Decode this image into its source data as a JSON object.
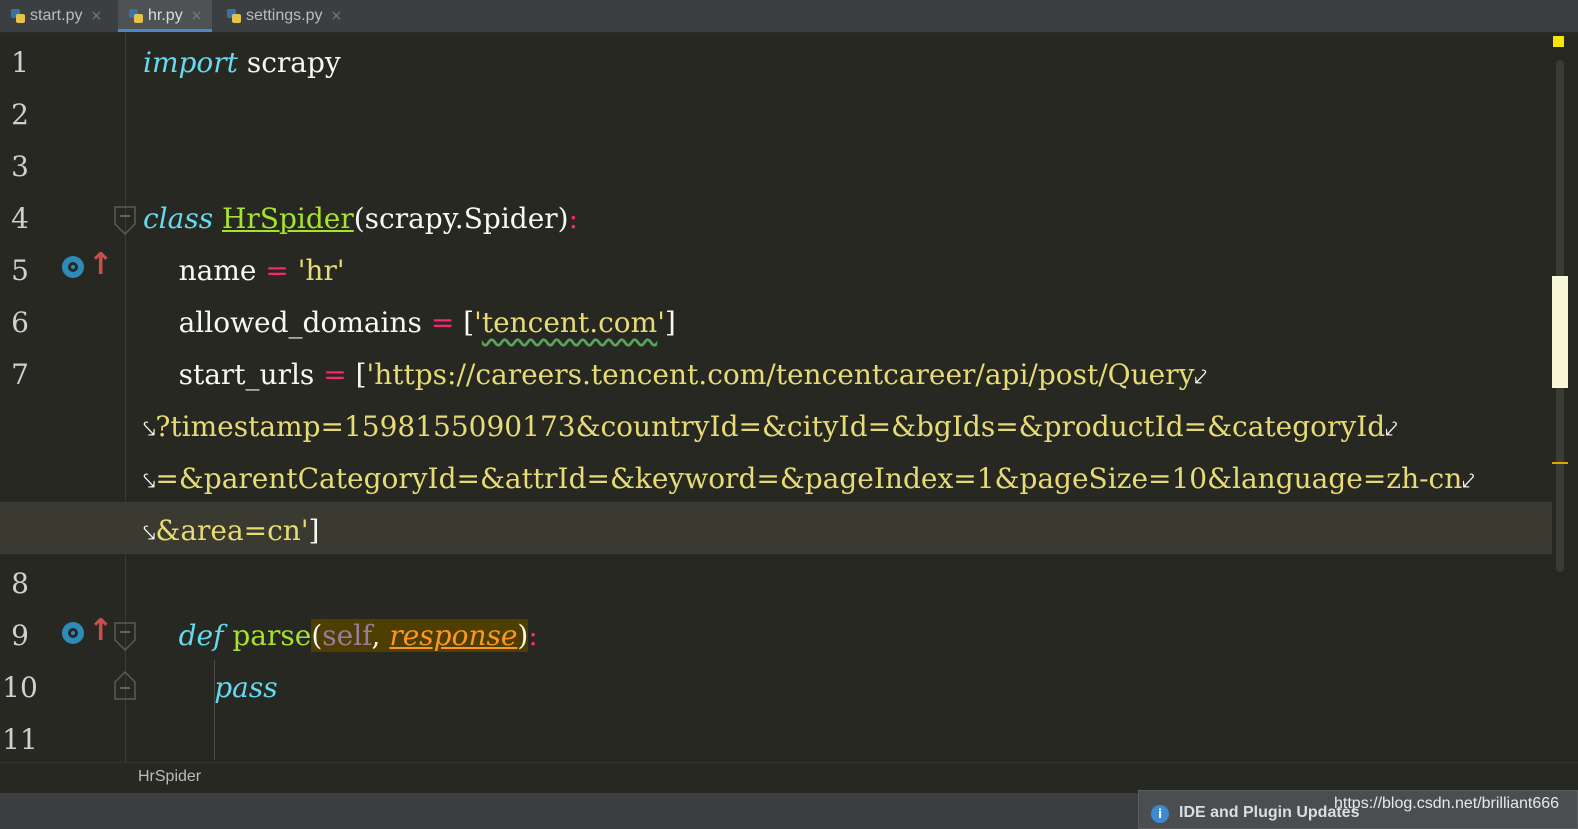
{
  "tabs": [
    {
      "label": "start.py",
      "close": "×",
      "active": false
    },
    {
      "label": "hr.py",
      "close": "×",
      "active": true
    },
    {
      "label": "settings.py",
      "close": "×",
      "active": false
    }
  ],
  "line_numbers": [
    "1",
    "2",
    "3",
    "4",
    "5",
    "6",
    "7",
    "8",
    "9",
    "10",
    "11"
  ],
  "code": {
    "l1": {
      "kw": "import",
      "rest": " scrapy"
    },
    "l4": {
      "kw": "class",
      "cls": "HrSpider",
      "mid": "(scrapy.Spider)",
      "colon": ":"
    },
    "l5": {
      "indent": "    ",
      "name": "name",
      "op": " = ",
      "str": "'hr'"
    },
    "l6": {
      "indent": "    ",
      "name": "allowed_domains",
      "op": " = ",
      "open": "[",
      "q1": "'",
      "dom": "tencent.com",
      "q2": "'",
      "close": "]"
    },
    "l7": {
      "indent": "    ",
      "name": "start_urls",
      "op": " = ",
      "open": "[",
      "str": "'https://careers.tencent.com/tencentcareer/api/post/Query"
    },
    "l7b": "?timestamp=1598155090173&countryId=&cityId=&bgIds=&productId=&categoryId",
    "l7c": "=&parentCategoryId=&attrId=&keyword=&pageIndex=1&pageSize=10&language=zh-cn",
    "l7d": {
      "str": "&area=cn'",
      "close": "]"
    },
    "l9": {
      "indent": "    ",
      "kw": "def",
      "fn": "parse",
      "open": "(",
      "self": "self",
      "comma": ", ",
      "param": "response",
      "close": ")",
      "colon": ":"
    },
    "l10": {
      "indent": "        ",
      "kw": "pass"
    },
    "wrap_end": "⤦",
    "wrap_start": "⤥"
  },
  "breadcrumb": "HrSpider",
  "notification": {
    "icon": "i",
    "text": "IDE and Plugin Updates"
  },
  "watermark": "https://blog.csdn.net/brilliant666",
  "colors": {
    "keyword": "#66d9ef",
    "class": "#a6e22e",
    "string": "#e6db74",
    "operator": "#f92672",
    "param": "#fd971f"
  }
}
